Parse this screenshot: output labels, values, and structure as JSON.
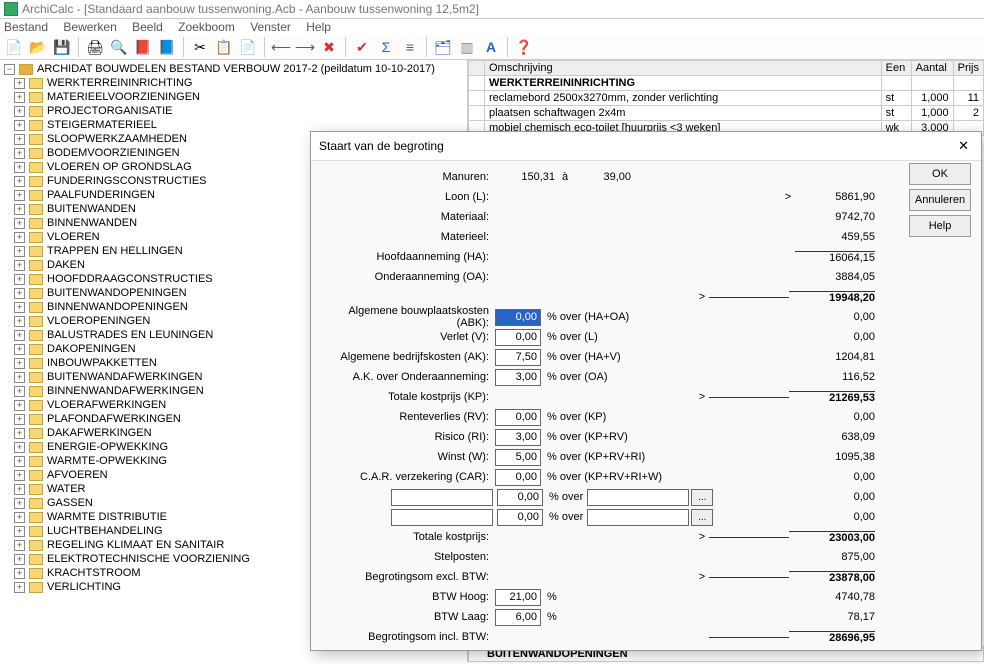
{
  "app": {
    "title": "ArchiCalc - [Standaard aanbouw tussenwoning.Acb - Aanbouw tussenwoning 12,5m2]"
  },
  "menubar": [
    "Bestand",
    "Bewerken",
    "Beeld",
    "Zoekboom",
    "Venster",
    "Help"
  ],
  "tree": {
    "root": "ARCHIDAT BOUWDELEN BESTAND VERBOUW 2017-2 (peildatum 10-10-2017)",
    "items": [
      "WERKTERREININRICHTING",
      "MATERIEELVOORZIENINGEN",
      "PROJECTORGANISATIE",
      "STEIGERMATERIEEL",
      "SLOOPWERKZAAMHEDEN",
      "BODEMVOORZIENINGEN",
      "VLOEREN OP GRONDSLAG",
      "FUNDERINGSCONSTRUCTIES",
      "PAALFUNDERINGEN",
      "BUITENWANDEN",
      "BINNENWANDEN",
      "VLOEREN",
      "TRAPPEN EN HELLINGEN",
      "DAKEN",
      "HOOFDDRAAGCONSTRUCTIES",
      "BUITENWANDOPENINGEN",
      "BINNENWANDOPENINGEN",
      "VLOEROPENINGEN",
      "BALUSTRADES EN LEUNINGEN",
      "DAKOPENINGEN",
      "INBOUWPAKKETTEN",
      "BUITENWANDAFWERKINGEN",
      "BINNENWANDAFWERKINGEN",
      "VLOERAFWERKINGEN",
      "PLAFONDAFWERKINGEN",
      "DAKAFWERKINGEN",
      "ENERGIE-OPWEKKING",
      "WARMTE-OPWEKKING",
      "AFVOEREN",
      "WATER",
      "GASSEN",
      "WARMTE DISTRIBUTIE",
      "LUCHTBEHANDELING",
      "REGELING KLIMAAT EN SANITAIR",
      "ELEKTROTECHNISCHE VOORZIENING",
      "KRACHTSTROOM",
      "VERLICHTING"
    ]
  },
  "grid": {
    "headers": {
      "omschrijving": "Omschrijving",
      "een": "Een",
      "aantal": "Aantal",
      "prijs": "Prijs"
    },
    "header_row": "WERKTERREININRICHTING",
    "rows": [
      {
        "omschrijving": "reclamebord 2500x3270mm, zonder verlichting",
        "een": "st",
        "aantal": "1,000",
        "prijs": "11"
      },
      {
        "omschrijving": "plaatsen schaftwagen 2x4m",
        "een": "st",
        "aantal": "1,000",
        "prijs": "2"
      },
      {
        "omschrijving": "mobiel chemisch eco-toilet [huurprijs <3 weken]",
        "een": "wk",
        "aantal": "3,000",
        "prijs": ""
      }
    ],
    "footer_row": "BUITENWANDOPENINGEN"
  },
  "dialog": {
    "title": "Staart van de begroting",
    "buttons": {
      "ok": "OK",
      "annuleren": "Annuleren",
      "help": "Help"
    },
    "labels": {
      "manuren": "Manuren:",
      "loon": "Loon (L):",
      "materiaal": "Materiaal:",
      "materieel": "Materieel:",
      "hoofdaanneming": "Hoofdaanneming (HA):",
      "onderaanneming": "Onderaanneming (OA):",
      "abk": "Algemene bouwplaatskosten (ABK):",
      "verlet": "Verlet (V):",
      "ak": "Algemene bedrijfskosten (AK):",
      "ak_oa": "A.K. over Onderaanneming:",
      "totale_kp": "Totale kostprijs (KP):",
      "rv": "Renteverlies (RV):",
      "ri": "Risico (RI):",
      "winst": "Winst (W):",
      "car": "C.A.R. verzekering (CAR):",
      "totale_kostprijs": "Totale kostprijs:",
      "stelposten": "Stelposten:",
      "begroting_excl": "Begrotingsom excl. BTW:",
      "btw_hoog": "BTW Hoog:",
      "btw_laag": "BTW Laag:",
      "begroting_incl": "Begrotingsom incl. BTW:"
    },
    "afters": {
      "over_ha_oa": "% over (HA+OA)",
      "over_l": "% over (L)",
      "over_ha_v": "% over (HA+V)",
      "over_oa": "% over (OA)",
      "over_kp": "% over (KP)",
      "over_kp_rv": "% over (KP+RV)",
      "over_kp_rv_ri": "% over (KP+RV+RI)",
      "over_kp_rv_ri_w": "% over (KP+RV+RI+W)",
      "over": "% over",
      "pct": "%",
      "a": "à"
    },
    "values": {
      "manuren": "150,31",
      "manuren_rate": "39,00",
      "loon": "5861,90",
      "materiaal": "9742,70",
      "materieel": "459,55",
      "hoofdaanneming": "16064,15",
      "onderaanneming": "3884,05",
      "subtotal1": "19948,20",
      "abk_pct": "0,00",
      "abk_val": "0,00",
      "verlet_pct": "0,00",
      "verlet_val": "0,00",
      "ak_pct": "7,50",
      "ak_val": "1204,81",
      "ak_oa_pct": "3,00",
      "ak_oa_val": "116,52",
      "totale_kp": "21269,53",
      "rv_pct": "0,00",
      "rv_val": "0,00",
      "ri_pct": "3,00",
      "ri_val": "638,09",
      "winst_pct": "5,00",
      "winst_val": "1095,38",
      "car_pct": "0,00",
      "car_val": "0,00",
      "custom1_pct": "0,00",
      "custom1_val": "0,00",
      "custom2_pct": "0,00",
      "custom2_val": "0,00",
      "totale_kostprijs": "23003,00",
      "stelposten": "875,00",
      "begroting_excl": "23878,00",
      "btw_hoog_pct": "21,00",
      "btw_hoog_val": "4740,78",
      "btw_laag_pct": "6,00",
      "btw_laag_val": "78,17",
      "begroting_incl": "28696,95"
    }
  }
}
